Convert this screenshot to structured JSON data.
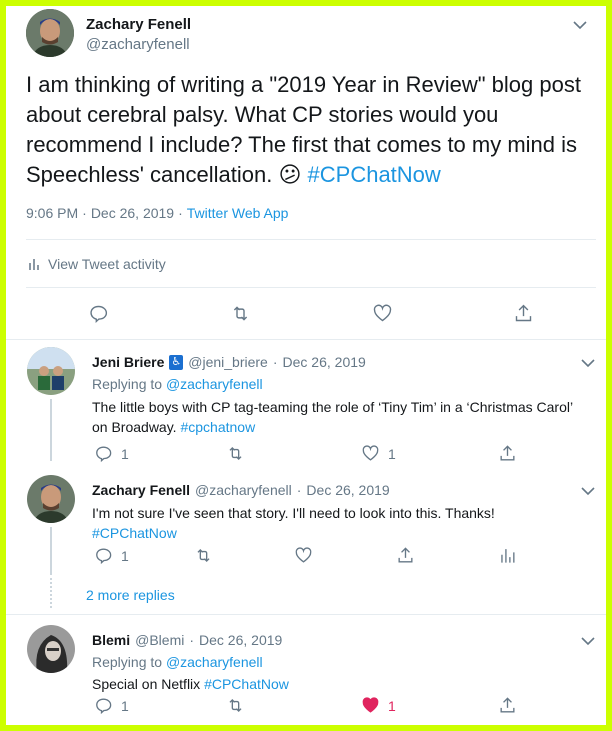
{
  "main_tweet": {
    "name": "Zachary Fenell",
    "handle": "@zacharyfenell",
    "text_part1": "I am thinking of writing a \"2019 Year in Review\" blog post about cerebral palsy. What CP stories would you recommend I include? The first that comes to my mind is Speechless' cancellation. ",
    "emoji": "😕",
    "hashtag": "#CPChatNow",
    "time": "9:06 PM",
    "sep": "·",
    "date": "Dec 26, 2019",
    "client": "Twitter Web App",
    "activity_label": "View Tweet activity"
  },
  "replies": [
    {
      "name": "Jeni Briere",
      "badge": "♿",
      "handle": "@jeni_briere",
      "sep": "·",
      "date": "Dec 26, 2019",
      "replying_prefix": "Replying to",
      "replying_to": "@zacharyfenell",
      "text": "The little boys with CP tag-teaming the role of ‘Tiny Tim’ in a ‘Christmas Carol’ on Broadway. ",
      "hashtag": "#cpchatnow",
      "reply_count": "1",
      "like_count": "1"
    },
    {
      "name": "Zachary Fenell",
      "handle": "@zacharyfenell",
      "sep": "·",
      "date": "Dec 26, 2019",
      "text": "I'm not sure I've seen that story. I'll need to look into this. Thanks!",
      "hashtag": "#CPChatNow",
      "reply_count": "1"
    },
    {
      "name": "Blemi",
      "handle": "@Blemi",
      "sep": "·",
      "date": "Dec 26, 2019",
      "replying_prefix": "Replying to",
      "replying_to": "@zacharyfenell",
      "text": "Special on Netflix ",
      "hashtag": "#CPChatNow",
      "reply_count": "1",
      "like_count": "1"
    }
  ],
  "more_replies": "2 more replies",
  "colors": {
    "accent": "#1b95e0",
    "muted": "#657786",
    "like": "#e0245e",
    "frame": "#ccff00"
  }
}
